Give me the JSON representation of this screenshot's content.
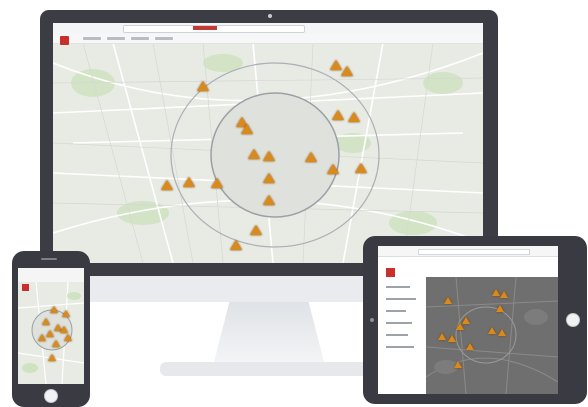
{
  "title": "",
  "colors": {
    "bezel": "#3c3d44",
    "map_background": "#e8ebe4",
    "map_roads": "#ffffff",
    "map_parks": "#cfe2c2",
    "ring_road": "#9aa0a6",
    "marker": "#d98a1d",
    "logo": "#c9302c"
  },
  "icons": {
    "marker": "warning-triangle-icon",
    "logo": "app-logo-icon"
  },
  "desktop": {
    "markers": [
      {
        "id": "m1"
      },
      {
        "id": "m2"
      },
      {
        "id": "m3"
      },
      {
        "id": "m4"
      },
      {
        "id": "m5"
      },
      {
        "id": "m6"
      },
      {
        "id": "m7"
      },
      {
        "id": "m8"
      },
      {
        "id": "m9"
      },
      {
        "id": "m10"
      },
      {
        "id": "m11"
      },
      {
        "id": "m12"
      },
      {
        "id": "m13"
      },
      {
        "id": "m14"
      },
      {
        "id": "m15"
      },
      {
        "id": "m16"
      },
      {
        "id": "m17"
      },
      {
        "id": "m18"
      },
      {
        "id": "m19"
      }
    ]
  },
  "phone": {
    "markers": [
      {
        "id": "p1"
      },
      {
        "id": "p2"
      },
      {
        "id": "p3"
      },
      {
        "id": "p4"
      },
      {
        "id": "p5"
      },
      {
        "id": "p6"
      },
      {
        "id": "p7"
      },
      {
        "id": "p8"
      },
      {
        "id": "p9"
      },
      {
        "id": "p10"
      }
    ]
  },
  "tablet": {
    "menu_items": [
      "",
      "",
      "",
      "",
      "",
      "",
      ""
    ],
    "markers": [
      {
        "id": "t1"
      },
      {
        "id": "t2"
      },
      {
        "id": "t3"
      },
      {
        "id": "t4"
      },
      {
        "id": "t5"
      },
      {
        "id": "t6"
      },
      {
        "id": "t7"
      },
      {
        "id": "t8"
      },
      {
        "id": "t9"
      },
      {
        "id": "t10"
      },
      {
        "id": "t11"
      },
      {
        "id": "t12"
      }
    ]
  }
}
